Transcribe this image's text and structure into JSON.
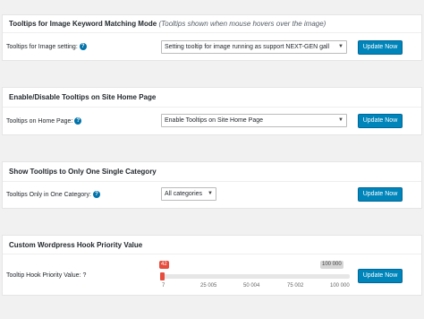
{
  "panels": [
    {
      "title": "Tooltips for Image Keyword Matching Mode",
      "note": "(Tooltips shown when mouse hovers over the image)",
      "label": "Tooltips for Image setting:",
      "select_value": "Setting tooltip for image running as support NEXT-GEN gall",
      "button": "Update Now"
    },
    {
      "title": "Enable/Disable Tooltips on Site Home Page",
      "label": "Tooltips on Home Page:",
      "select_value": "Enable Tooltips on Site Home Page",
      "button": "Update Now"
    },
    {
      "title": "Show Tooltips to Only One Single Category",
      "label": "Tooltips Only in One Category:",
      "select_value": "All categories",
      "button": "Update Now"
    },
    {
      "title": "Custom Wordpress Hook Priority Value",
      "label": "Tooltip Hook Priority Value: ?",
      "button": "Update Now",
      "slider": {
        "current": "42",
        "max_label": "100 000",
        "value": 42,
        "min": 7,
        "max": 100000,
        "ticks": [
          "7",
          "25 005",
          "50 004",
          "75 002",
          "100 000"
        ]
      }
    }
  ],
  "colors": {
    "button": "#0085ba",
    "help_icon": "#0073aa",
    "slider_accent": "#e74c3c"
  }
}
